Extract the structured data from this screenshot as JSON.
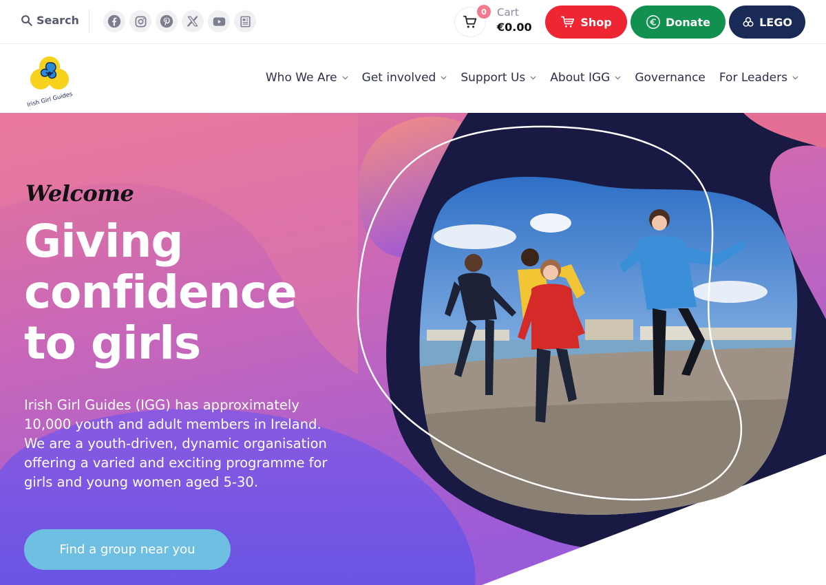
{
  "topbar": {
    "search_label": "Search",
    "socials": [
      "facebook-icon",
      "instagram-icon",
      "pinterest-icon",
      "x-icon",
      "youtube-icon",
      "newsletter-icon"
    ],
    "cart": {
      "count": "0",
      "label": "Cart",
      "total": "€0.00"
    },
    "buttons": {
      "shop": "Shop",
      "donate": "Donate",
      "lego": "LEGO"
    }
  },
  "logo": {
    "text": "Irish Girl Guides"
  },
  "nav": {
    "items": [
      {
        "label": "Who We Are",
        "has_dropdown": true
      },
      {
        "label": "Get involved",
        "has_dropdown": true
      },
      {
        "label": "Support Us",
        "has_dropdown": true
      },
      {
        "label": "About IGG",
        "has_dropdown": true
      },
      {
        "label": "Governance",
        "has_dropdown": false
      },
      {
        "label": "For Leaders",
        "has_dropdown": true
      }
    ]
  },
  "hero": {
    "welcome": "Welcome",
    "headline": [
      "Giving",
      "confidence",
      "to girls"
    ],
    "intro": "Irish Girl Guides (IGG) has approximately 10,000 youth and adult members in Ireland. We are a youth-driven, dynamic organisation offering a varied and exciting programme for girls and young women aged 5-30.",
    "cta": "Find a group near you"
  },
  "colors": {
    "shop": "#ee2633",
    "donate": "#12904f",
    "lego": "#1a2a57",
    "cta": "#6fbfe3",
    "hero_pink": "#e96f97",
    "hero_purple": "#7a55e6",
    "hero_dark": "#191a43"
  }
}
